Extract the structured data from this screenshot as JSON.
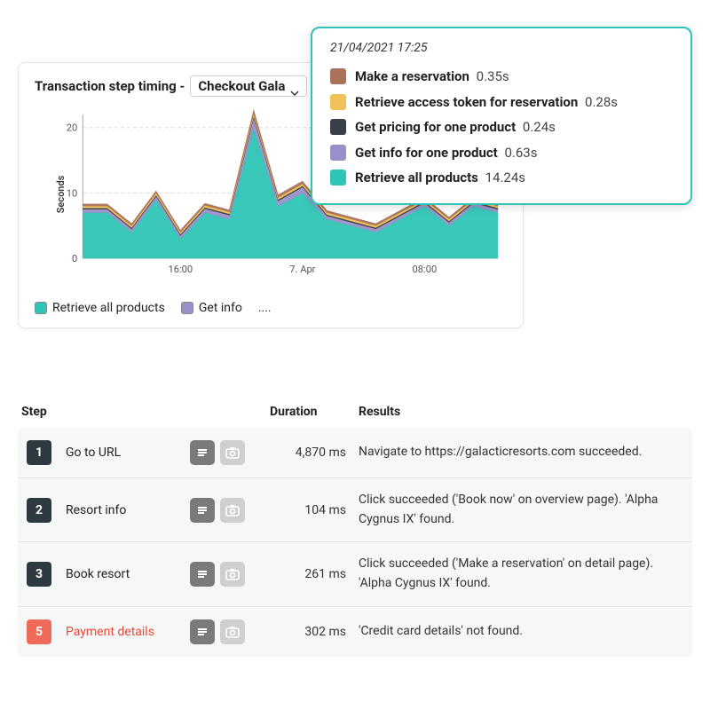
{
  "chart": {
    "title_prefix": "Transaction step timing - ",
    "dropdown_label": "Checkout Gala",
    "y_axis_label": "Seconds",
    "legend": [
      {
        "label": "Retrieve all products",
        "color": "#2ec4b6"
      },
      {
        "label": "Get info",
        "color": "#9b8fc9"
      }
    ],
    "legend_more": "...."
  },
  "tooltip": {
    "timestamp": "21/04/2021 17:25",
    "items": [
      {
        "color": "#a8735a",
        "label": "Make a reservation",
        "value": "0.35s"
      },
      {
        "color": "#f2c25a",
        "label": "Retrieve access token for reservation",
        "value": "0.28s"
      },
      {
        "color": "#3a4048",
        "label": "Get pricing for one product",
        "value": "0.24s"
      },
      {
        "color": "#9b8fc9",
        "label": "Get info for one product",
        "value": "0.63s"
      },
      {
        "color": "#2ec4b6",
        "label": "Retrieve all products",
        "value": "14.24s"
      }
    ]
  },
  "table": {
    "headers": {
      "step": "Step",
      "duration": "Duration",
      "results": "Results"
    },
    "rows": [
      {
        "num": "1",
        "badge_color": "#2e3a3f",
        "name": "Go to URL",
        "duration": "4,870 ms",
        "results": "Navigate to https://galacticresorts.com succeeded.",
        "error": false
      },
      {
        "num": "2",
        "badge_color": "#2e3a3f",
        "name": "Resort info",
        "duration": "104 ms",
        "results": "Click succeeded ('Book now' on overview page). 'Alpha Cygnus IX' found.",
        "error": false
      },
      {
        "num": "3",
        "badge_color": "#2e3a3f",
        "name": "Book resort",
        "duration": "261 ms",
        "results": "Click succeeded ('Make a reservation' on detail page). 'Alpha Cygnus IX' found.",
        "error": false
      },
      {
        "num": "5",
        "badge_color": "#f06a5a",
        "name": "Payment details",
        "duration": "302 ms",
        "results": "'Credit card details' not found.",
        "error": true
      }
    ]
  },
  "chart_data": {
    "type": "area",
    "title": "Transaction step timing - Checkout Gala",
    "ylabel": "Seconds",
    "ylim": [
      0,
      22
    ],
    "y_ticks": [
      0,
      10,
      20
    ],
    "x_categories": [
      "16:00",
      "7. Apr",
      "08:00"
    ],
    "series": [
      {
        "name": "Retrieve all products",
        "color": "#2ec4b6",
        "values": [
          7,
          7,
          4,
          9,
          3,
          7,
          6,
          20,
          8,
          10,
          6,
          5,
          4,
          6,
          8,
          5,
          8,
          7
        ]
      },
      {
        "name": "Get info for one product",
        "color": "#9b8fc9",
        "values": [
          0.5,
          0.5,
          0.5,
          0.5,
          0.5,
          0.6,
          0.6,
          1.5,
          0.8,
          0.9,
          0.5,
          0.5,
          0.5,
          0.5,
          0.5,
          0.5,
          0.5,
          0.5
        ]
      },
      {
        "name": "Get pricing for one product",
        "color": "#3a4048",
        "values": [
          0.2,
          0.2,
          0.2,
          0.2,
          0.2,
          0.2,
          0.2,
          0.3,
          0.2,
          0.2,
          0.2,
          0.2,
          0.2,
          0.2,
          0.2,
          0.2,
          0.2,
          0.2
        ]
      },
      {
        "name": "Retrieve access token for reservation",
        "color": "#f2c25a",
        "values": [
          0.3,
          0.3,
          0.3,
          0.3,
          0.3,
          0.3,
          0.3,
          0.4,
          0.3,
          0.3,
          0.3,
          0.3,
          0.3,
          0.3,
          0.3,
          0.3,
          0.3,
          0.3
        ]
      },
      {
        "name": "Make a reservation",
        "color": "#a8735a",
        "values": [
          0.3,
          0.3,
          0.3,
          0.3,
          0.3,
          0.3,
          0.3,
          0.5,
          0.4,
          0.4,
          0.3,
          0.3,
          0.3,
          0.3,
          0.3,
          0.3,
          0.3,
          0.3
        ]
      }
    ]
  }
}
